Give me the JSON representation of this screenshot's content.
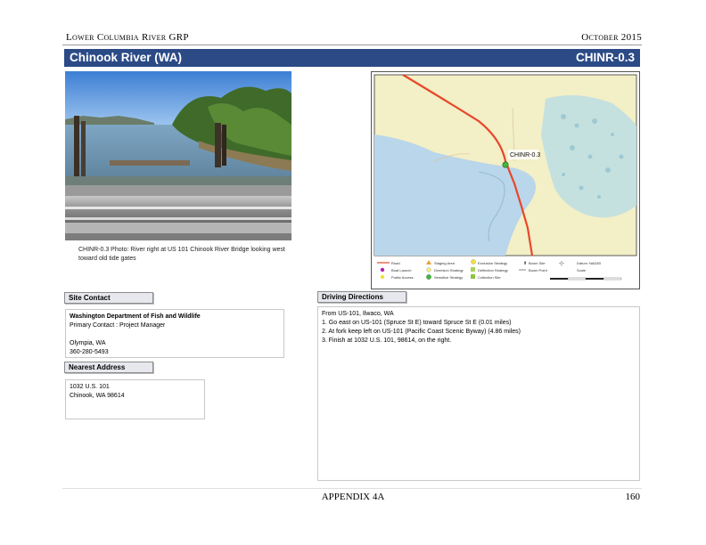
{
  "header": {
    "left": "Lower Columbia River GRP",
    "right": "October 2015"
  },
  "title": {
    "site_name": "Chinook River (WA)",
    "site_code": "CHINR-0.3"
  },
  "photo": {
    "caption": "CHINR-0.3 Photo: River right at US 101 Chinook River Bridge looking west toward old tide gates"
  },
  "map": {
    "site_label": "CHINR-0.3",
    "legend": {
      "row1": [
        "Road",
        "Staging Area",
        "Exclusion Strategy",
        "Boom Site",
        "Datum: NAD83"
      ],
      "row2": [
        "Boat Launch",
        "Diversion Strategy",
        "Deflection Strategy",
        "Boom Point",
        "Scale"
      ],
      "row3": [
        "Public Access",
        "Sensitive Strategy",
        "Collection Site"
      ]
    },
    "colors": {
      "water": "#b9d6ea",
      "land": "#f3efc6",
      "marsh": "#b9dce1",
      "highway": "#e8472b",
      "site": "#44b83f"
    }
  },
  "site_contact": {
    "label": "Site Contact",
    "org": "Washington Department of Fish and Wildlife",
    "primary": "Primary Contact : Project Manager",
    "city": "Olympia, WA",
    "phone": "360-280-5493"
  },
  "nearest_address": {
    "label": "Nearest Address",
    "line1": "1032 U.S. 101",
    "line2": "Chinook, WA 98614"
  },
  "driving_directions": {
    "label": "Driving Directions",
    "lines": [
      "From US-101, Ilwaco, WA",
      "1. Go east on US-101 (Spruce St E) toward Spruce St E (0.01 miles)",
      "2. At fork keep left on US-101 (Pacific Coast Scenic Byway) (4.86 miles)",
      "3. Finish at 1032 U.S. 101, 98614, on the right."
    ]
  },
  "footer": {
    "center": "APPENDIX 4A",
    "page": "160"
  }
}
